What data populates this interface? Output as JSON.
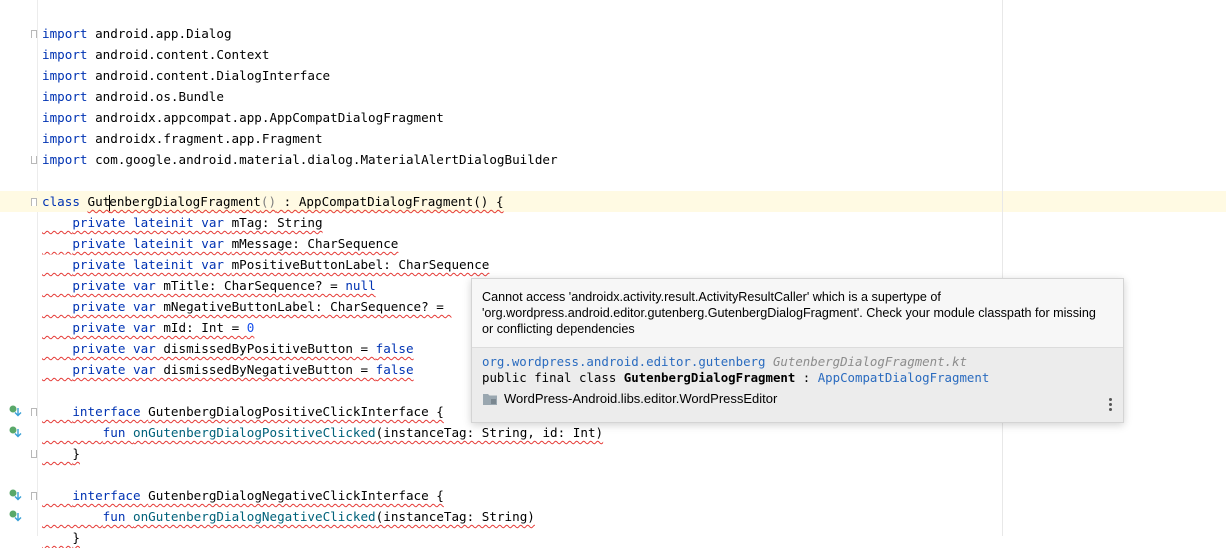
{
  "editor": {
    "lines": [
      [
        {
          "t": "import ",
          "c": "kw"
        },
        {
          "t": "android.app.Dialog"
        }
      ],
      [
        {
          "t": "import ",
          "c": "kw"
        },
        {
          "t": "android.content.Context"
        }
      ],
      [
        {
          "t": "import ",
          "c": "kw"
        },
        {
          "t": "android.content.DialogInterface"
        }
      ],
      [
        {
          "t": "import ",
          "c": "kw"
        },
        {
          "t": "android.os.Bundle"
        }
      ],
      [
        {
          "t": "import ",
          "c": "kw"
        },
        {
          "t": "androidx.appcompat.app.AppCompatDialogFragment"
        }
      ],
      [
        {
          "t": "import ",
          "c": "kw"
        },
        {
          "t": "androidx.fragment.app.Fragment"
        }
      ],
      [
        {
          "t": "import ",
          "c": "kw"
        },
        {
          "t": "com.google.android.material.dialog.MaterialAlertDialogBuilder"
        }
      ],
      [],
      [
        {
          "t": "class ",
          "c": "kw"
        },
        {
          "t": "Gut",
          "c": "sq"
        },
        {
          "caret": true
        },
        {
          "t": "enbergDialogFragment",
          "c": "sq"
        },
        {
          "t": "()",
          "c": "gray sq"
        },
        {
          "t": " : AppCompatDialogFragment() {",
          "c": "sq"
        }
      ],
      [
        {
          "t": "    ",
          "c": "sq"
        },
        {
          "t": "private lateinit var ",
          "c": "kw sq"
        },
        {
          "t": "mTag: String",
          "c": "sq"
        }
      ],
      [
        {
          "t": "    ",
          "c": "sq"
        },
        {
          "t": "private lateinit var ",
          "c": "kw sq"
        },
        {
          "t": "mMessage: CharSequence",
          "c": "sq"
        }
      ],
      [
        {
          "t": "    ",
          "c": "sq"
        },
        {
          "t": "private lateinit var ",
          "c": "kw sq"
        },
        {
          "t": "mPositiveButtonLabel: CharSequence",
          "c": "sq"
        }
      ],
      [
        {
          "t": "    ",
          "c": "sq"
        },
        {
          "t": "private var ",
          "c": "kw sq"
        },
        {
          "t": "mTitle: CharSequence? = ",
          "c": "sq"
        },
        {
          "t": "null",
          "c": "kw sq"
        }
      ],
      [
        {
          "t": "    ",
          "c": "sq"
        },
        {
          "t": "private var ",
          "c": "kw sq"
        },
        {
          "t": "mNegativeButtonLabel: CharSequence? = ",
          "c": "sq"
        }
      ],
      [
        {
          "t": "    ",
          "c": "sq"
        },
        {
          "t": "private var ",
          "c": "kw sq"
        },
        {
          "t": "mId: Int = ",
          "c": "sq"
        },
        {
          "t": "0",
          "c": "num sq"
        }
      ],
      [
        {
          "t": "    ",
          "c": "sq"
        },
        {
          "t": "private var ",
          "c": "kw sq"
        },
        {
          "t": "dismissedByPositiveButton = ",
          "c": "sq"
        },
        {
          "t": "false",
          "c": "kw sq"
        }
      ],
      [
        {
          "t": "    ",
          "c": "sq"
        },
        {
          "t": "private var ",
          "c": "kw sq"
        },
        {
          "t": "dismissedByNegativeButton = ",
          "c": "sq"
        },
        {
          "t": "false",
          "c": "kw sq"
        }
      ],
      [],
      [
        {
          "t": "    ",
          "c": "sq"
        },
        {
          "t": "interface ",
          "c": "kw sq"
        },
        {
          "t": "GutenbergDialogPositiveClickInterface {",
          "c": "sq"
        }
      ],
      [
        {
          "t": "        ",
          "c": "sq"
        },
        {
          "t": "fun ",
          "c": "kw sq"
        },
        {
          "t": "onGutenbergDialogPositiveClicked",
          "c": "fn sq"
        },
        {
          "t": "(instanceTag: String, id: Int)",
          "c": "sq"
        }
      ],
      [
        {
          "t": "    ",
          "c": "sq"
        },
        {
          "t": "}",
          "c": "sq"
        }
      ],
      [],
      [
        {
          "t": "    ",
          "c": "sq"
        },
        {
          "t": "interface ",
          "c": "kw sq"
        },
        {
          "t": "GutenbergDialogNegativeClickInterface {",
          "c": "sq"
        }
      ],
      [
        {
          "t": "        ",
          "c": "sq"
        },
        {
          "t": "fun ",
          "c": "kw sq"
        },
        {
          "t": "onGutenbergDialogNegativeClicked",
          "c": "fn sq"
        },
        {
          "t": "(instanceTag: String)",
          "c": "sq"
        }
      ],
      [
        {
          "t": "    ",
          "c": "sq"
        },
        {
          "t": "}",
          "c": "sq"
        }
      ]
    ]
  },
  "popup": {
    "message": "Cannot access 'androidx.activity.result.ActivityResultCaller' which is a supertype of 'org.wordpress.android.editor.gutenberg.GutenbergDialogFragment'. Check your module classpath for missing or conflicting dependencies",
    "package": "org.wordpress.android.editor.gutenberg",
    "file": "GutenbergDialogFragment.kt",
    "decl_prefix": "public final class ",
    "decl_name": "GutenbergDialogFragment",
    "decl_sep": " : ",
    "decl_super": "AppCompatDialogFragment",
    "module": "WordPress-Android.libs.editor.WordPressEditor"
  }
}
